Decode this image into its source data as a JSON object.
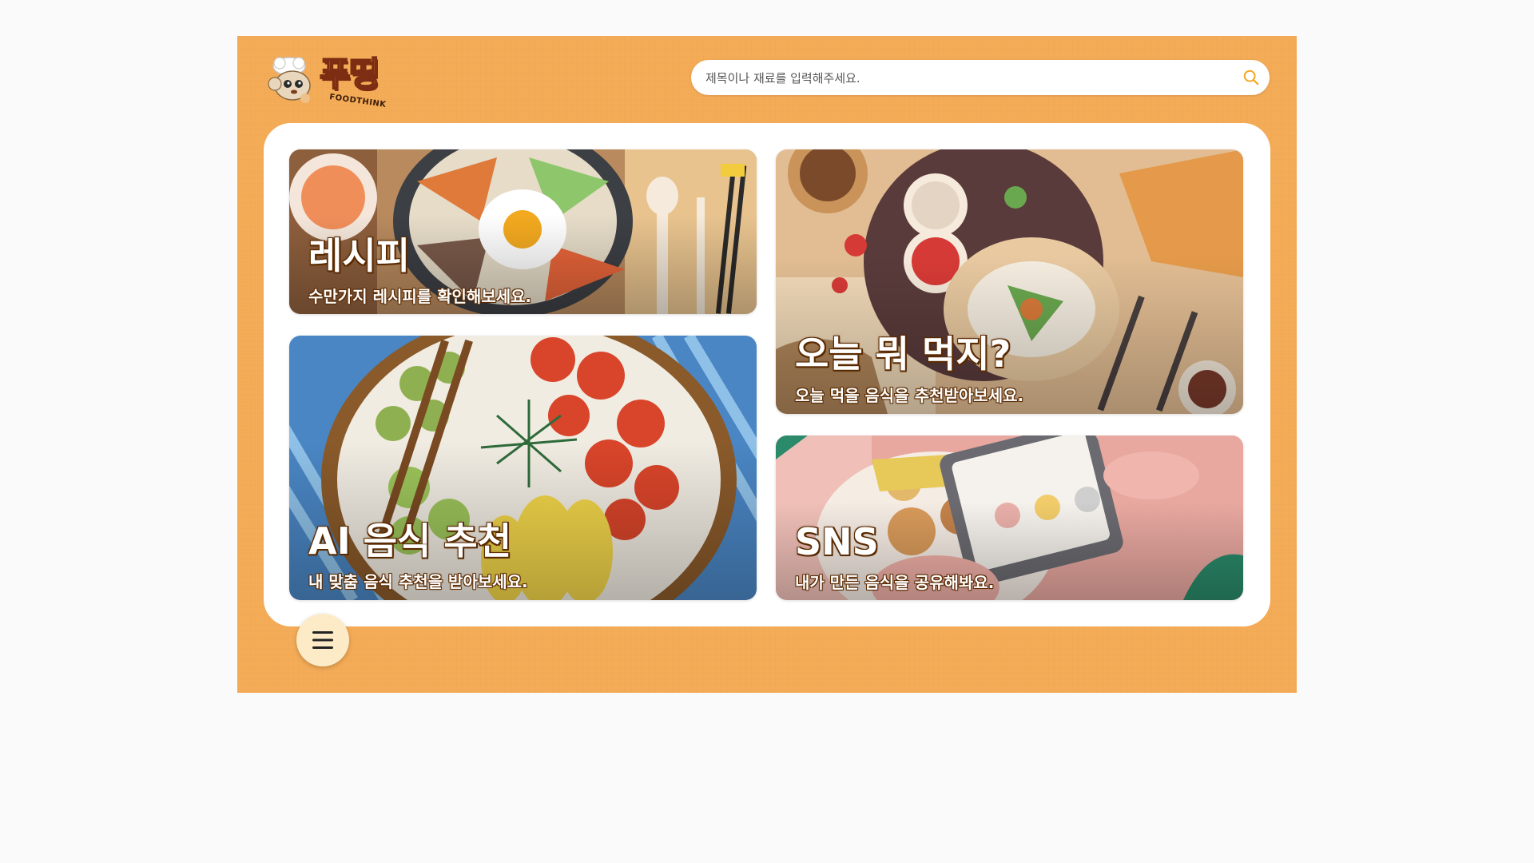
{
  "logo": {
    "title": "푸띵",
    "subtitle": "FOODTHINK"
  },
  "search": {
    "placeholder": "제목이나 재료를 입력해주세요.",
    "value": ""
  },
  "cards": {
    "recipe": {
      "title": "레시피",
      "desc": "수만가지 레시피를 확인해보세요."
    },
    "today": {
      "title": "오늘 뭐 먹지?",
      "desc": "오늘 먹을 음식을 추천받아보세요."
    },
    "ai": {
      "title": "AI 음식 추천",
      "desc": "내 맞춤 음식 추천을 받아보세요."
    },
    "sns": {
      "title": "SNS",
      "desc": "내가 만든 음식을 공유해봐요."
    }
  },
  "colors": {
    "app_background": "#f6ad58",
    "panel": "#ffffff",
    "search_icon": "#f5a623",
    "menu_button": "#fdebc8"
  },
  "icons": {
    "search": "search-icon",
    "menu": "hamburger-menu-icon",
    "logo": "chef-mascot-icon"
  }
}
